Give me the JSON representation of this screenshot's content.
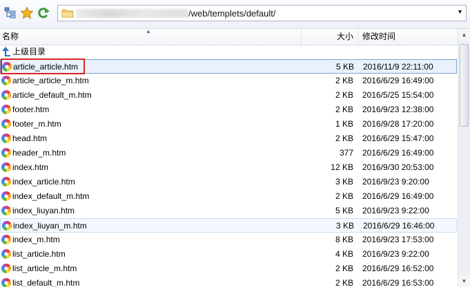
{
  "toolbar": {
    "buttons": [
      {
        "name": "tree-view-icon",
        "icon": "tree-view"
      },
      {
        "name": "favorite-star-icon",
        "icon": "star"
      },
      {
        "name": "refresh-icon",
        "icon": "refresh"
      }
    ],
    "path": "/web/templets/default/"
  },
  "columns": {
    "name": "名称",
    "size": "大小",
    "modified": "修改时间"
  },
  "parent_dir": "上级目录",
  "files": [
    {
      "name": "article_article.htm",
      "size": "5 KB",
      "date": "2016/11/9 22:11:00",
      "state": "selected"
    },
    {
      "name": "article_article_m.htm",
      "size": "2 KB",
      "date": "2016/6/29 16:49:00"
    },
    {
      "name": "article_default_m.htm",
      "size": "2 KB",
      "date": "2016/5/25 15:54:00"
    },
    {
      "name": "footer.htm",
      "size": "2 KB",
      "date": "2016/9/23 12:38:00"
    },
    {
      "name": "footer_m.htm",
      "size": "1 KB",
      "date": "2016/9/28 17:20:00"
    },
    {
      "name": "head.htm",
      "size": "2 KB",
      "date": "2016/6/29 15:47:00"
    },
    {
      "name": "header_m.htm",
      "size": "377",
      "date": "2016/6/29 16:49:00"
    },
    {
      "name": "index.htm",
      "size": "12 KB",
      "date": "2016/9/30 20:53:00"
    },
    {
      "name": "index_article.htm",
      "size": "3 KB",
      "date": "2016/9/23 9:20:00"
    },
    {
      "name": "index_default_m.htm",
      "size": "2 KB",
      "date": "2016/6/29 16:49:00"
    },
    {
      "name": "index_liuyan.htm",
      "size": "5 KB",
      "date": "2016/9/23 9:22:00"
    },
    {
      "name": "index_liuyan_m.htm",
      "size": "3 KB",
      "date": "2016/6/29 16:46:00",
      "state": "hover"
    },
    {
      "name": "index_m.htm",
      "size": "8 KB",
      "date": "2016/9/23 17:53:00"
    },
    {
      "name": "list_article.htm",
      "size": "4 KB",
      "date": "2016/9/23 9:22:00"
    },
    {
      "name": "list_article_m.htm",
      "size": "2 KB",
      "date": "2016/6/29 16:52:00"
    },
    {
      "name": "list_default_m.htm",
      "size": "2 KB",
      "date": "2016/6/29 16:53:00"
    }
  ],
  "colors": {
    "selection_fill": "#e9f2fc",
    "selection_border": "#7da2ce",
    "highlight_box": "#e02020"
  }
}
